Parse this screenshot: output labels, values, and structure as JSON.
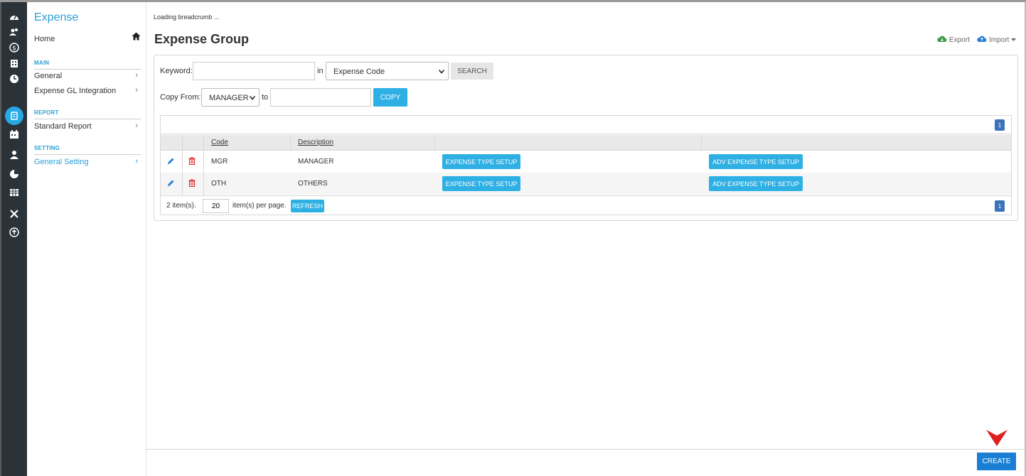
{
  "sidebar": {
    "title": "Expense",
    "home": "Home",
    "sections": {
      "main": "MAIN",
      "report": "REPORT",
      "setting": "SETTING"
    },
    "items": {
      "general": "General",
      "gl_integration": "Expense GL Integration",
      "standard_report": "Standard Report",
      "general_setting": "General Setting"
    },
    "chevron": "›"
  },
  "header": {
    "breadcrumb": "Loading breadcrumb ...",
    "title": "Expense Group",
    "export": "Export",
    "import": "Import"
  },
  "search": {
    "keyword_label": "Keyword:",
    "keyword_value": "",
    "in_label": "in",
    "field_selected": "Expense Code",
    "search_button": "SEARCH"
  },
  "copy": {
    "label": "Copy From:",
    "from_selected": "MANAGER",
    "to_label": "to",
    "to_value": "",
    "button": "COPY"
  },
  "grid": {
    "page": "1",
    "columns": {
      "code": "Code",
      "description": "Description"
    },
    "rows": [
      {
        "code": "MGR",
        "description": "MANAGER",
        "btn1": "EXPENSE TYPE SETUP",
        "btn2": "ADV EXPENSE TYPE SETUP"
      },
      {
        "code": "OTH",
        "description": "OTHERS",
        "btn1": "EXPENSE TYPE SETUP",
        "btn2": "ADV EXPENSE TYPE SETUP"
      }
    ],
    "footer": {
      "count": "2 item(s).",
      "per_page_value": "20",
      "per_page_label": "item(s) per page.",
      "refresh": "REFRESH"
    }
  },
  "actions": {
    "create": "CREATE"
  },
  "colors": {
    "accent": "#2a9fd6",
    "button_blue": "#2eb0e4",
    "create_blue": "#1a7fd4",
    "rail_bg": "#2b3238",
    "pointer_red": "#e02020"
  }
}
